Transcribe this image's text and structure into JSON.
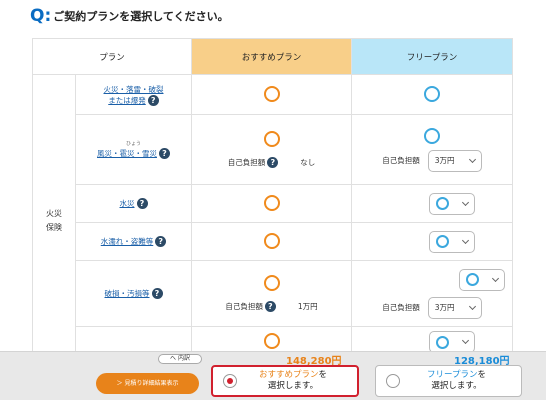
{
  "question": {
    "label": "Q:",
    "text": "ご契約プランを選択してください。"
  },
  "table": {
    "headers": {
      "plan": "プラン",
      "recommended": "おすすめプラン",
      "free": "フリープラン"
    },
    "category": "火災\n保険",
    "rows": [
      {
        "item": "火災・落雷・破裂\nまたは爆発"
      },
      {
        "item_ruby": "ひょう",
        "item": "風災・雹災・雪災",
        "rec_deduct_label": "自己負担額",
        "rec_deduct_value": "なし",
        "free_deduct_label": "自己負担額",
        "free_deduct_value": "3万円"
      },
      {
        "item": "水災"
      },
      {
        "item": "水濡れ・盗難等"
      },
      {
        "item": "破損・汚損等",
        "rec_deduct_label": "自己負担額",
        "rec_deduct_value": "1万円",
        "free_deduct_label": "自己負担額",
        "free_deduct_value": "3万円"
      },
      {
        "item": ""
      }
    ]
  },
  "footer": {
    "toggle_label": "へ 内訳",
    "rec_price": "148,280円",
    "free_price": "128,180円",
    "detail_button": "＞ 見積り詳細結果表示",
    "choose_rec_line1_accent": "おすすめプラン",
    "choose_rec_line1_rest": "を",
    "choose_rec_line2": "選択します。",
    "choose_free_line1_accent": "フリープラン",
    "choose_free_line1_rest": "を",
    "choose_free_line2": "選択します。"
  },
  "icons": [
    "help-icon",
    "circle-mark-icon",
    "chevron-down-icon",
    "radio-icon"
  ],
  "colors": {
    "accent_orange": "#f08a1c",
    "accent_blue": "#3ba8de",
    "selected_red": "#d1202e",
    "question_blue": "#0a6cc2"
  }
}
